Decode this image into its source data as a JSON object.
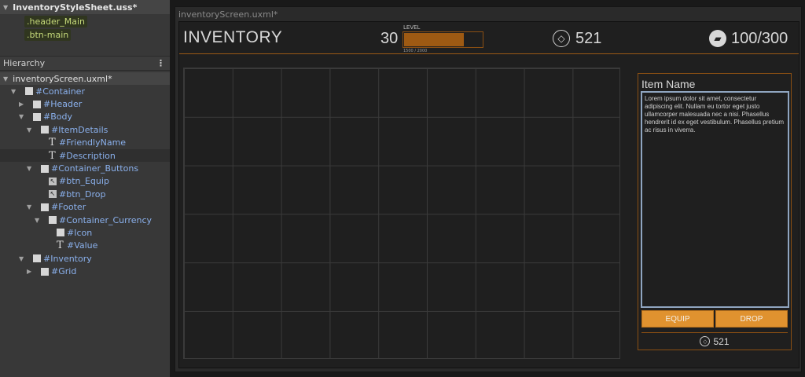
{
  "stylesheet": {
    "title": "InventoryStyleSheet.uss*",
    "selectors": [
      ".header_Main",
      ".btn-main"
    ]
  },
  "hierarchy": {
    "panel_title": "Hierarchy",
    "menu_icon": "⋮",
    "document": "inventoryScreen.uxml*",
    "nodes": [
      {
        "label": "#Container",
        "icon": "box",
        "expanded": true
      },
      {
        "label": "#Header",
        "icon": "box",
        "expanded": false
      },
      {
        "label": "#Body",
        "icon": "box",
        "expanded": true
      },
      {
        "label": "#ItemDetails",
        "icon": "box",
        "expanded": true
      },
      {
        "label": "#FriendlyName",
        "icon": "text"
      },
      {
        "label": "#Description",
        "icon": "text"
      },
      {
        "label": "#Container_Buttons",
        "icon": "box",
        "expanded": true
      },
      {
        "label": "#btn_Equip",
        "icon": "button"
      },
      {
        "label": "#btn_Drop",
        "icon": "button"
      },
      {
        "label": "#Footer",
        "icon": "box",
        "expanded": true
      },
      {
        "label": "#Container_Currency",
        "icon": "box",
        "expanded": true
      },
      {
        "label": "#Icon",
        "icon": "box"
      },
      {
        "label": "#Value",
        "icon": "text"
      },
      {
        "label": "#Inventory",
        "icon": "box",
        "expanded": true
      },
      {
        "label": "#Grid",
        "icon": "box",
        "expanded": false
      }
    ]
  },
  "viewport": {
    "title": "inventoryScreen.uxml*"
  },
  "inventory": {
    "title": "INVENTORY",
    "level": {
      "number": "30",
      "label": "LEVEL",
      "progress": 0.75,
      "xp_text": "1500 / 2000"
    },
    "currency": {
      "icon": "diamond-icon",
      "value": "521"
    },
    "weight": {
      "icon": "weight-icon",
      "value": "100/300"
    },
    "grid": {
      "columns": 9,
      "rows": 6
    },
    "details": {
      "item_name": "Item Name",
      "description": "Lorem ipsum dolor sit amet, consectetur adipiscing elit. Nullam eu tortor eget justo ullamcorper malesuada nec a nisi. Phasellus hendrerit id ex eget vestibulum. Phasellus pretium ac risus in viverra.",
      "equip_label": "EQUIP",
      "drop_label": "DROP",
      "price": "521"
    }
  },
  "colors": {
    "accent": "#e0922f",
    "accent_dark": "#9e5a13",
    "hierarchy_link": "#8ab0ec"
  }
}
